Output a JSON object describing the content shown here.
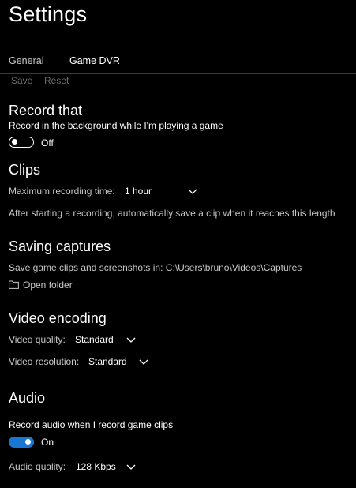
{
  "header": {
    "title": "Settings"
  },
  "tabs": [
    {
      "label": "General"
    },
    {
      "label": "Game DVR"
    }
  ],
  "commands": {
    "save": "Save",
    "reset": "Reset"
  },
  "record_that": {
    "heading": "Record that",
    "background_label": "Record in the background while I'm playing a game",
    "background_toggle": {
      "state_label": "Off",
      "on": false
    }
  },
  "clips": {
    "heading": "Clips",
    "max_time_label": "Maximum recording time:",
    "max_time_value": "1 hour",
    "description": "After starting a recording, automatically save a clip when it reaches this length"
  },
  "saving": {
    "heading": "Saving captures",
    "path_text": "Save game clips and screenshots in: C:\\Users\\bruno\\Videos\\Captures",
    "open_folder": "Open folder"
  },
  "video_encoding": {
    "heading": "Video encoding",
    "quality_label": "Video quality:",
    "quality_value": "Standard",
    "resolution_label": "Video resolution:",
    "resolution_value": "Standard"
  },
  "audio": {
    "heading": "Audio",
    "record_label": "Record audio when I record game clips",
    "record_toggle": {
      "state_label": "On",
      "on": true
    },
    "quality_label": "Audio quality:",
    "quality_value": "128 Kbps"
  },
  "colors": {
    "background": "#000000",
    "accent": "#1976d2",
    "text_primary": "#ffffff",
    "text_secondary": "#c8c8c8",
    "text_disabled": "#6b6b6b"
  },
  "icons": {
    "dropdown": "chevron-down-icon",
    "folder": "folder-icon"
  }
}
